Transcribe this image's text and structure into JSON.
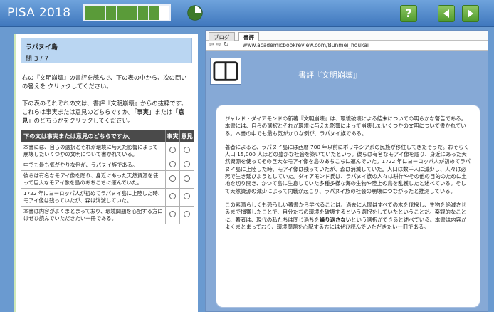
{
  "header": {
    "brand": "PISA 2018",
    "progress": {
      "segments_total": 8,
      "segments_completed": 7
    },
    "icons": [
      "timer-icon",
      "help-icon",
      "back-arrow-icon",
      "forward-arrow-icon"
    ],
    "help_label": "?",
    "accent_color": "#5a9b39"
  },
  "question": {
    "unit_title": "ラパヌイ島",
    "question_number": "問 3 / 7",
    "instruction1": "右の『文明崩壊』の書評を読んで、下の表の中から、次の問いの答えを クリックしてください。",
    "instruction2_pre": "下の表のそれぞれの文は、書評『文明崩壊』からの抜粋です。これらは事実または意見のどちらですか。「",
    "instruction2_fact": "事実",
    "instruction2_mid": "」または「",
    "instruction2_opinion": "意見",
    "instruction2_post": "」のどちらかをクリックしてください。",
    "table": {
      "header_statement": "下の文は事実または意見のどちらですか。",
      "header_fact": "事実",
      "header_opinion": "意見",
      "rows": [
        "本書には、自らの選択とそれが環境に与えた影響によって崩壊したいくつかの文明について書かれている。",
        "中でも最も気がかりな例が、ラパヌイ族である。",
        "彼らは有名なモアイ像を彫り、身近にあった天然資源を使って巨大なモアイ像を島のあちこちに運んでいた。",
        "1722 年にヨーロッパ人が初めてラパヌイ島に上陸した時、モアイ像は残っていたが、森は消滅していた。",
        "本書は内容がよくまとまっており、環境問題を心配する方にはぜひ読んでいただきたい一冊である。"
      ]
    }
  },
  "browser": {
    "tabs": [
      "ブログ",
      "書評"
    ],
    "active_tab": "書評",
    "url": "www.academicbookreview.com/Bunmei_houkai",
    "review_title": "書評『文明崩壊』"
  },
  "article": {
    "p1": "ジャレド・ダイアモンドの新著『文明崩壊』は、環境破壊による結末についての明らかな警告である。本書には、自らの選択とそれが環境に与えた影響によって崩壊したいくつかの文明について書かれている。本書の中でも最も気がかりな例が、ラパヌイ族である。",
    "p2": "著者によると、ラパヌイ島には西暦 700 年以前にポリネシア系の民族が移住してきたそうだ。おそらく人口 15,000 人ほどの豊かな社会を築いていたという。彼らは有名なモアイ像を彫り、身近にあった天然資源を使ってその巨大なモアイ像を島のあちこちに運んでいた。1722 年にヨーロッパ人が初めてラパヌイ島に上陸した時、モアイ像は残っていたが、森は消滅していた。人口は数千人に減少し、人々は必死で生き延びようとしていた。ダイアモンド氏は、ラパヌイ族の人々は耕作やその他の目的のために土地を切り開き、かつて島に生息していた多種多様な海の生物や陸上の鳥を乱獲したと述べている。そして天然資源の減少によって内戦が起こり、ラパヌイ族の社会の崩壊につながったと推測している。",
    "p3_pre": "この素晴らしくも恐ろしい著書から学べることは、過去に人間はすべての木を伐採し、生物を絶滅させるまで捕獲したことで、自分たちの環境を破壊するという選択をしていたということだ。楽観的なことに、著者は、現代の私たちは同じ過ちを",
    "p3_bold": "繰り返さない",
    "p3_post": "という選択ができると述べている。本書は内容がよくまとまっており、環境問題を心配する方にはぜひ読んでいただきたい一冊である。"
  }
}
